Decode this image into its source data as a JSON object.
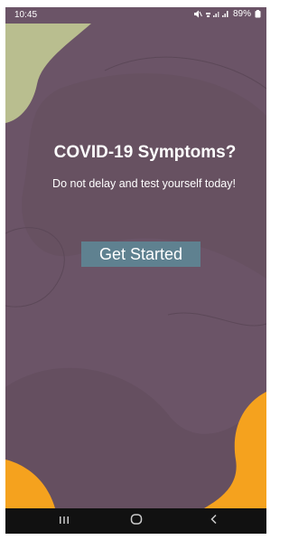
{
  "status_bar": {
    "time": "10:45",
    "battery": "89%",
    "icons": [
      "mute-icon",
      "signal-icon",
      "battery-icon"
    ]
  },
  "main": {
    "title": "COVID-19 Symptoms?",
    "subtitle": "Do not delay and test yourself today!",
    "button_label": "Get Started"
  },
  "nav_bar": {
    "buttons": [
      "recent-apps-icon",
      "home-icon",
      "back-icon"
    ]
  },
  "colors": {
    "background": "#6b5467",
    "blob_green": "#b9be8f",
    "blob_orange": "#f5a21e",
    "button": "#5f8190",
    "nav_bar": "#111111"
  }
}
